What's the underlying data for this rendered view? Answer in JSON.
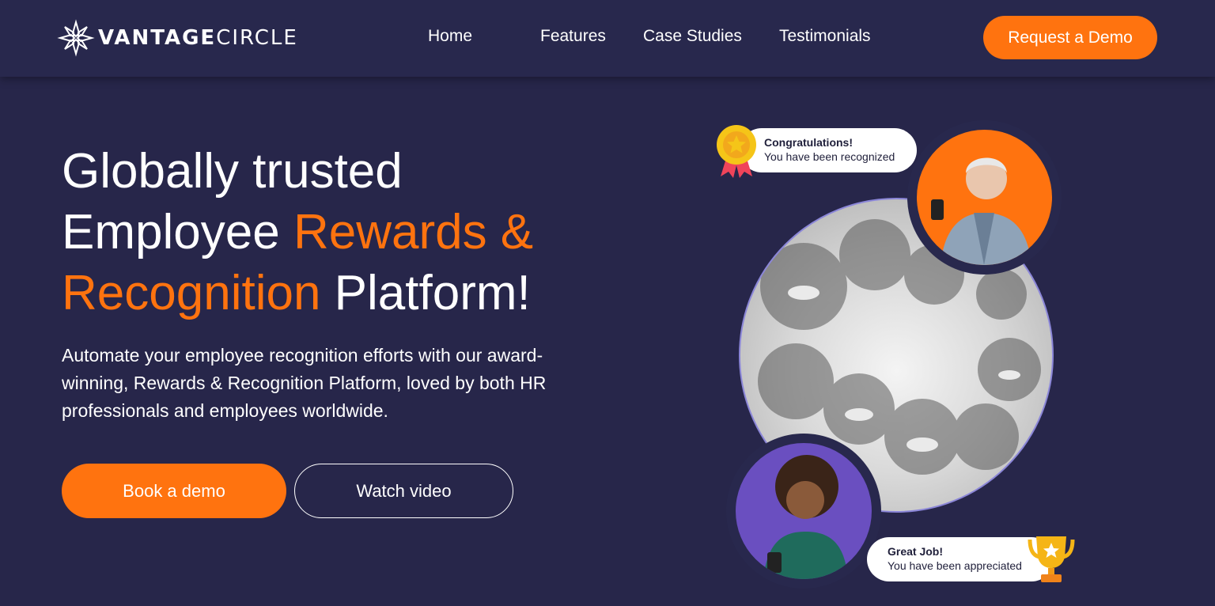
{
  "brand": {
    "logo_bold": "VANTAGE",
    "logo_light": "CIRCLE",
    "accent_color": "#ff730f",
    "background_color": "#27264a"
  },
  "nav": {
    "links": [
      "Home",
      "Features",
      "Case Studies",
      "Testimonials"
    ],
    "cta_label": "Request a Demo"
  },
  "hero": {
    "title_part1": "Globally trusted",
    "title_part2": "Employee",
    "title_accent1": "Rewards &",
    "title_accent2": "Recognition",
    "title_part3": "Platform!",
    "description": "Automate your employee recognition efforts with our award-winning, Rewards & Recognition Platform, loved by both HR professionals and employees worldwide.",
    "primary_button": "Book a demo",
    "secondary_button": "Watch video"
  },
  "notifications": {
    "congrats_title": "Congratulations!",
    "congrats_sub": "You have been recognized",
    "great_title": "Great Job!",
    "great_sub": "You have been appreciated"
  },
  "icons": [
    "vantage-logo-icon",
    "medal-icon",
    "trophy-icon"
  ]
}
